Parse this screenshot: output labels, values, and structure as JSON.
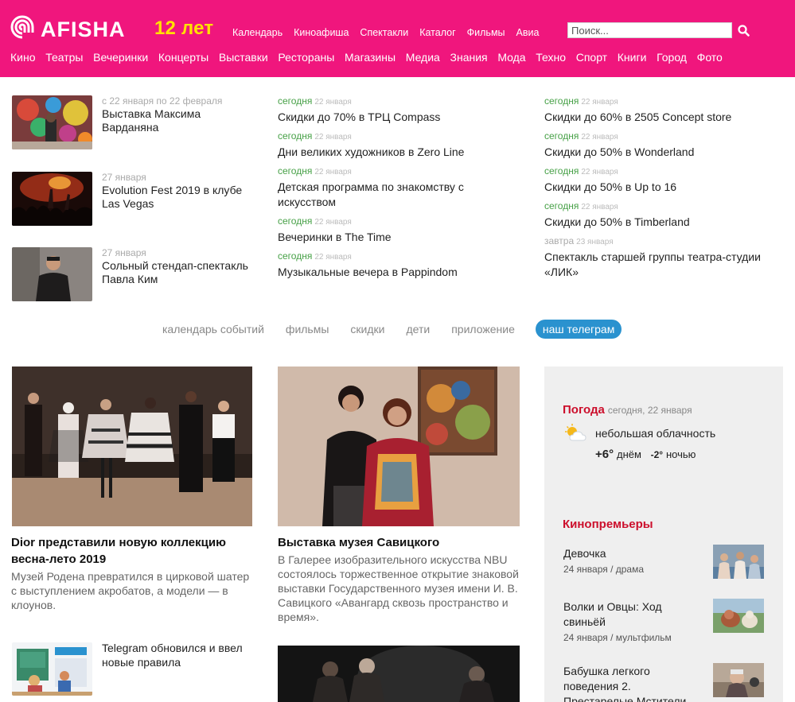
{
  "header": {
    "logo_text": "AFISHA",
    "years": "12 лет",
    "top_links": [
      "Календарь",
      "Киноафиша",
      "Спектакли",
      "Каталог",
      "Фильмы",
      "Авиа"
    ],
    "search_placeholder": "Поиск...",
    "main_nav": [
      "Кино",
      "Театры",
      "Вечеринки",
      "Концерты",
      "Выставки",
      "Рестораны",
      "Магазины",
      "Медиа",
      "Знания",
      "Мода",
      "Техно",
      "Спорт",
      "Книги",
      "Город",
      "Фото"
    ],
    "colors": {
      "bar": "#f0167d",
      "years": "#ffe100"
    }
  },
  "events": [
    {
      "date": "с 22 января по 22 февраля",
      "title": "Выставка Максима Варданяна",
      "thumb": "art-painting"
    },
    {
      "date": "27 января",
      "title": "Evolution Fest 2019 в клубе Las Vegas",
      "thumb": "concert-crowd"
    },
    {
      "date": "27 января",
      "title": "Сольный стендап-спектакль Павла Ким",
      "thumb": "performer-portrait"
    }
  ],
  "promos_mid": [
    {
      "when": "сегодня",
      "day": "22 января",
      "title": "Скидки до 70% в ТРЦ Compass"
    },
    {
      "when": "сегодня",
      "day": "22 января",
      "title": "Дни великих художников в Zero Line"
    },
    {
      "when": "сегодня",
      "day": "22 января",
      "title": "Детская программа по знакомству с искусством"
    },
    {
      "when": "сегодня",
      "day": "22 января",
      "title": "Вечеринки в The Time"
    },
    {
      "when": "сегодня",
      "day": "22 января",
      "title": "Музыкальные вечера в Pappindom"
    }
  ],
  "promos_right": [
    {
      "when": "сегодня",
      "day": "22 января",
      "title": "Скидки до 60% в 2505 Concept store"
    },
    {
      "when": "сегодня",
      "day": "22 января",
      "title": "Скидки до 50% в Wonderland"
    },
    {
      "when": "сегодня",
      "day": "22 января",
      "title": "Скидки до 50% в Up to 16"
    },
    {
      "when": "сегодня",
      "day": "22 января",
      "title": "Скидки до 50% в Timberland"
    },
    {
      "when": "завтра",
      "day": "23 января",
      "title": "Спектакль старшей группы театра-студии «ЛИК»"
    }
  ],
  "pills": [
    "календарь событий",
    "фильмы",
    "скидки",
    "дети",
    "приложение",
    "наш телеграм"
  ],
  "articles": [
    {
      "title": "Dior представили новую коллекцию весна-лето 2019",
      "desc": "Музей Родена превратился в цирковой шатер с выступлением акробатов, а модели — в клоунов.",
      "image": "fashion-runway-photo"
    },
    {
      "title": "Выставка музея Савицкого",
      "desc": "В Галерее изобразительного искусства NBU состоялось торжественное открытие знаковой выставки Государственного музея имени И. В. Савицкого «Авангард сквозь пространство и время».",
      "image": "gallery-women-photo"
    },
    {
      "title": "Telegram обновился и ввел новые правила",
      "image": "telegram-illustration"
    },
    {
      "image": "theatre-stage-photo"
    }
  ],
  "sidebar": {
    "weather": {
      "heading": "Погода",
      "date": "сегодня, 22 января",
      "condition": "небольшая облачность",
      "icon": "partly-cloudy-icon",
      "day_temp": "+6°",
      "day_label": "днём",
      "night_temp": "-2°",
      "night_label": "ночью"
    },
    "premieres_heading": "Кинопремьеры",
    "movies": [
      {
        "title": "Девочка",
        "meta": "24 января / драма",
        "thumb": "girl-film-still"
      },
      {
        "title": "Волки и Овцы: Ход свиньёй",
        "meta": "24 января / мультфильм",
        "thumb": "animation-still"
      },
      {
        "title": "Бабушка легкого поведения 2. Престарелые Мстители",
        "thumb": "comedy-still"
      }
    ],
    "colors": {
      "heading": "#cc0f2c",
      "panel": "#efefef"
    }
  }
}
